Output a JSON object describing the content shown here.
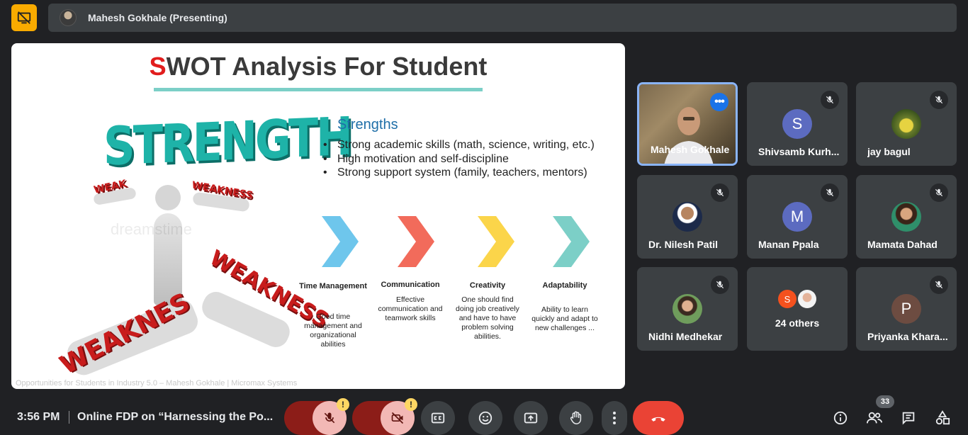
{
  "presenter_bar": {
    "label": "Mahesh Gokhale (Presenting)"
  },
  "slide": {
    "title_first_letter": "S",
    "title_rest": "WOT Analysis For Student",
    "illustration": {
      "main_word": "STRENGTH",
      "weak_word_1": "WEAKNES",
      "weak_word_2": "WEAKNESS",
      "weak_word_3": "WEAKNESS",
      "weak_word_4": "WEAK",
      "watermark": "dreamstime"
    },
    "section_heading": "Strengths",
    "bullets": [
      "Strong academic skills (math, science, writing, etc.)",
      "High motivation and self-discipline",
      "Strong support system (family, teachers, mentors)"
    ],
    "columns": [
      {
        "title": "Time Management",
        "desc": "Good time management and organizational abilities",
        "color": "#6ec6ec"
      },
      {
        "title": "Communication",
        "desc": "Effective communication and teamwork skills",
        "color": "#f26b5b"
      },
      {
        "title": "Creativity",
        "desc": "One should find doing job creatively and have to have problem solving abilities.",
        "color": "#fbd54a"
      },
      {
        "title": "Adaptability",
        "desc": "Ability to learn quickly and adapt to new challenges ...",
        "color": "#7ccfc7"
      }
    ],
    "footer": "Opportunities for Students in Industry 5.0 – Mahesh Gokhale | Micromax Systems"
  },
  "participants": [
    {
      "name": "Mahesh Gokhale",
      "type": "video"
    },
    {
      "name": "Shivsamb Kurh...",
      "initial": "S",
      "color": "#5c6bc0"
    },
    {
      "name": "jay bagul",
      "type": "photo"
    },
    {
      "name": "Dr. Nilesh Patil",
      "type": "photo"
    },
    {
      "name": "Manan Ppala",
      "initial": "M",
      "color": "#5c6bc0"
    },
    {
      "name": "Mamata Dahad",
      "type": "photo"
    },
    {
      "name": "Nidhi Medhekar",
      "type": "photo"
    },
    {
      "name": "24 others",
      "mini_initial": "S"
    },
    {
      "name": "Priyanka Khara...",
      "initial": "P",
      "color": "#6d4c41"
    }
  ],
  "bottom": {
    "time": "3:56 PM",
    "meeting_title": "Online FDP on “Harnessing the Po...",
    "warning_glyph": "!",
    "people_count": "33",
    "more_glyph": "•••"
  }
}
